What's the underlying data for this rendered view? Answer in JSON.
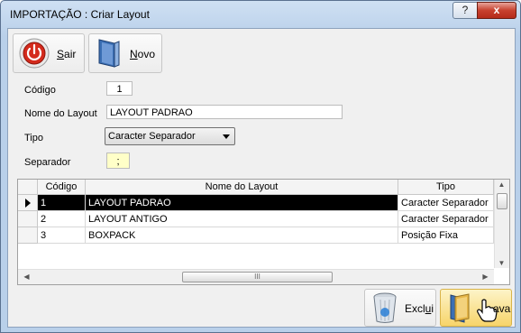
{
  "window": {
    "title": "IMPORTAÇÃO : Criar Layout",
    "help": "?",
    "close": "x"
  },
  "toolbar": {
    "sair_pre": "",
    "sair_ul": "S",
    "sair_post": "air",
    "novo_pre": "",
    "novo_ul": "N",
    "novo_post": "ovo"
  },
  "form": {
    "codigo_label": "Código",
    "codigo_value": "1",
    "nome_label": "Nome do Layout",
    "nome_value": "LAYOUT PADRAO",
    "tipo_label": "Tipo",
    "tipo_value": "Caracter Separador",
    "separador_label": "Separador",
    "separador_value": ";"
  },
  "grid": {
    "headers": [
      "Código",
      "Nome do Layout",
      "Tipo"
    ],
    "rows": [
      {
        "codigo": "1",
        "nome": "LAYOUT PADRAO",
        "tipo": "Caracter Separador",
        "selected": true
      },
      {
        "codigo": "2",
        "nome": "LAYOUT ANTIGO",
        "tipo": "Caracter Separador",
        "selected": false
      },
      {
        "codigo": "3",
        "nome": "BOXPACK",
        "tipo": "Posição Fixa",
        "selected": false
      }
    ],
    "scroll_grip": "III"
  },
  "footer": {
    "exclui_pre": "Excl",
    "exclui_ul": "u",
    "exclui_post": "i",
    "grava_pre": "",
    "grava_ul": "",
    "grava_post": "ava"
  },
  "colors": {
    "accent": "#f7d46a",
    "selection": "#000000",
    "close": "#c7402e"
  },
  "icons": {
    "sair": "power-icon",
    "novo": "new-document-icon",
    "exclui": "recycle-bin-icon",
    "grava": "save-folder-icon",
    "cursor": "hand-pointer-icon"
  }
}
